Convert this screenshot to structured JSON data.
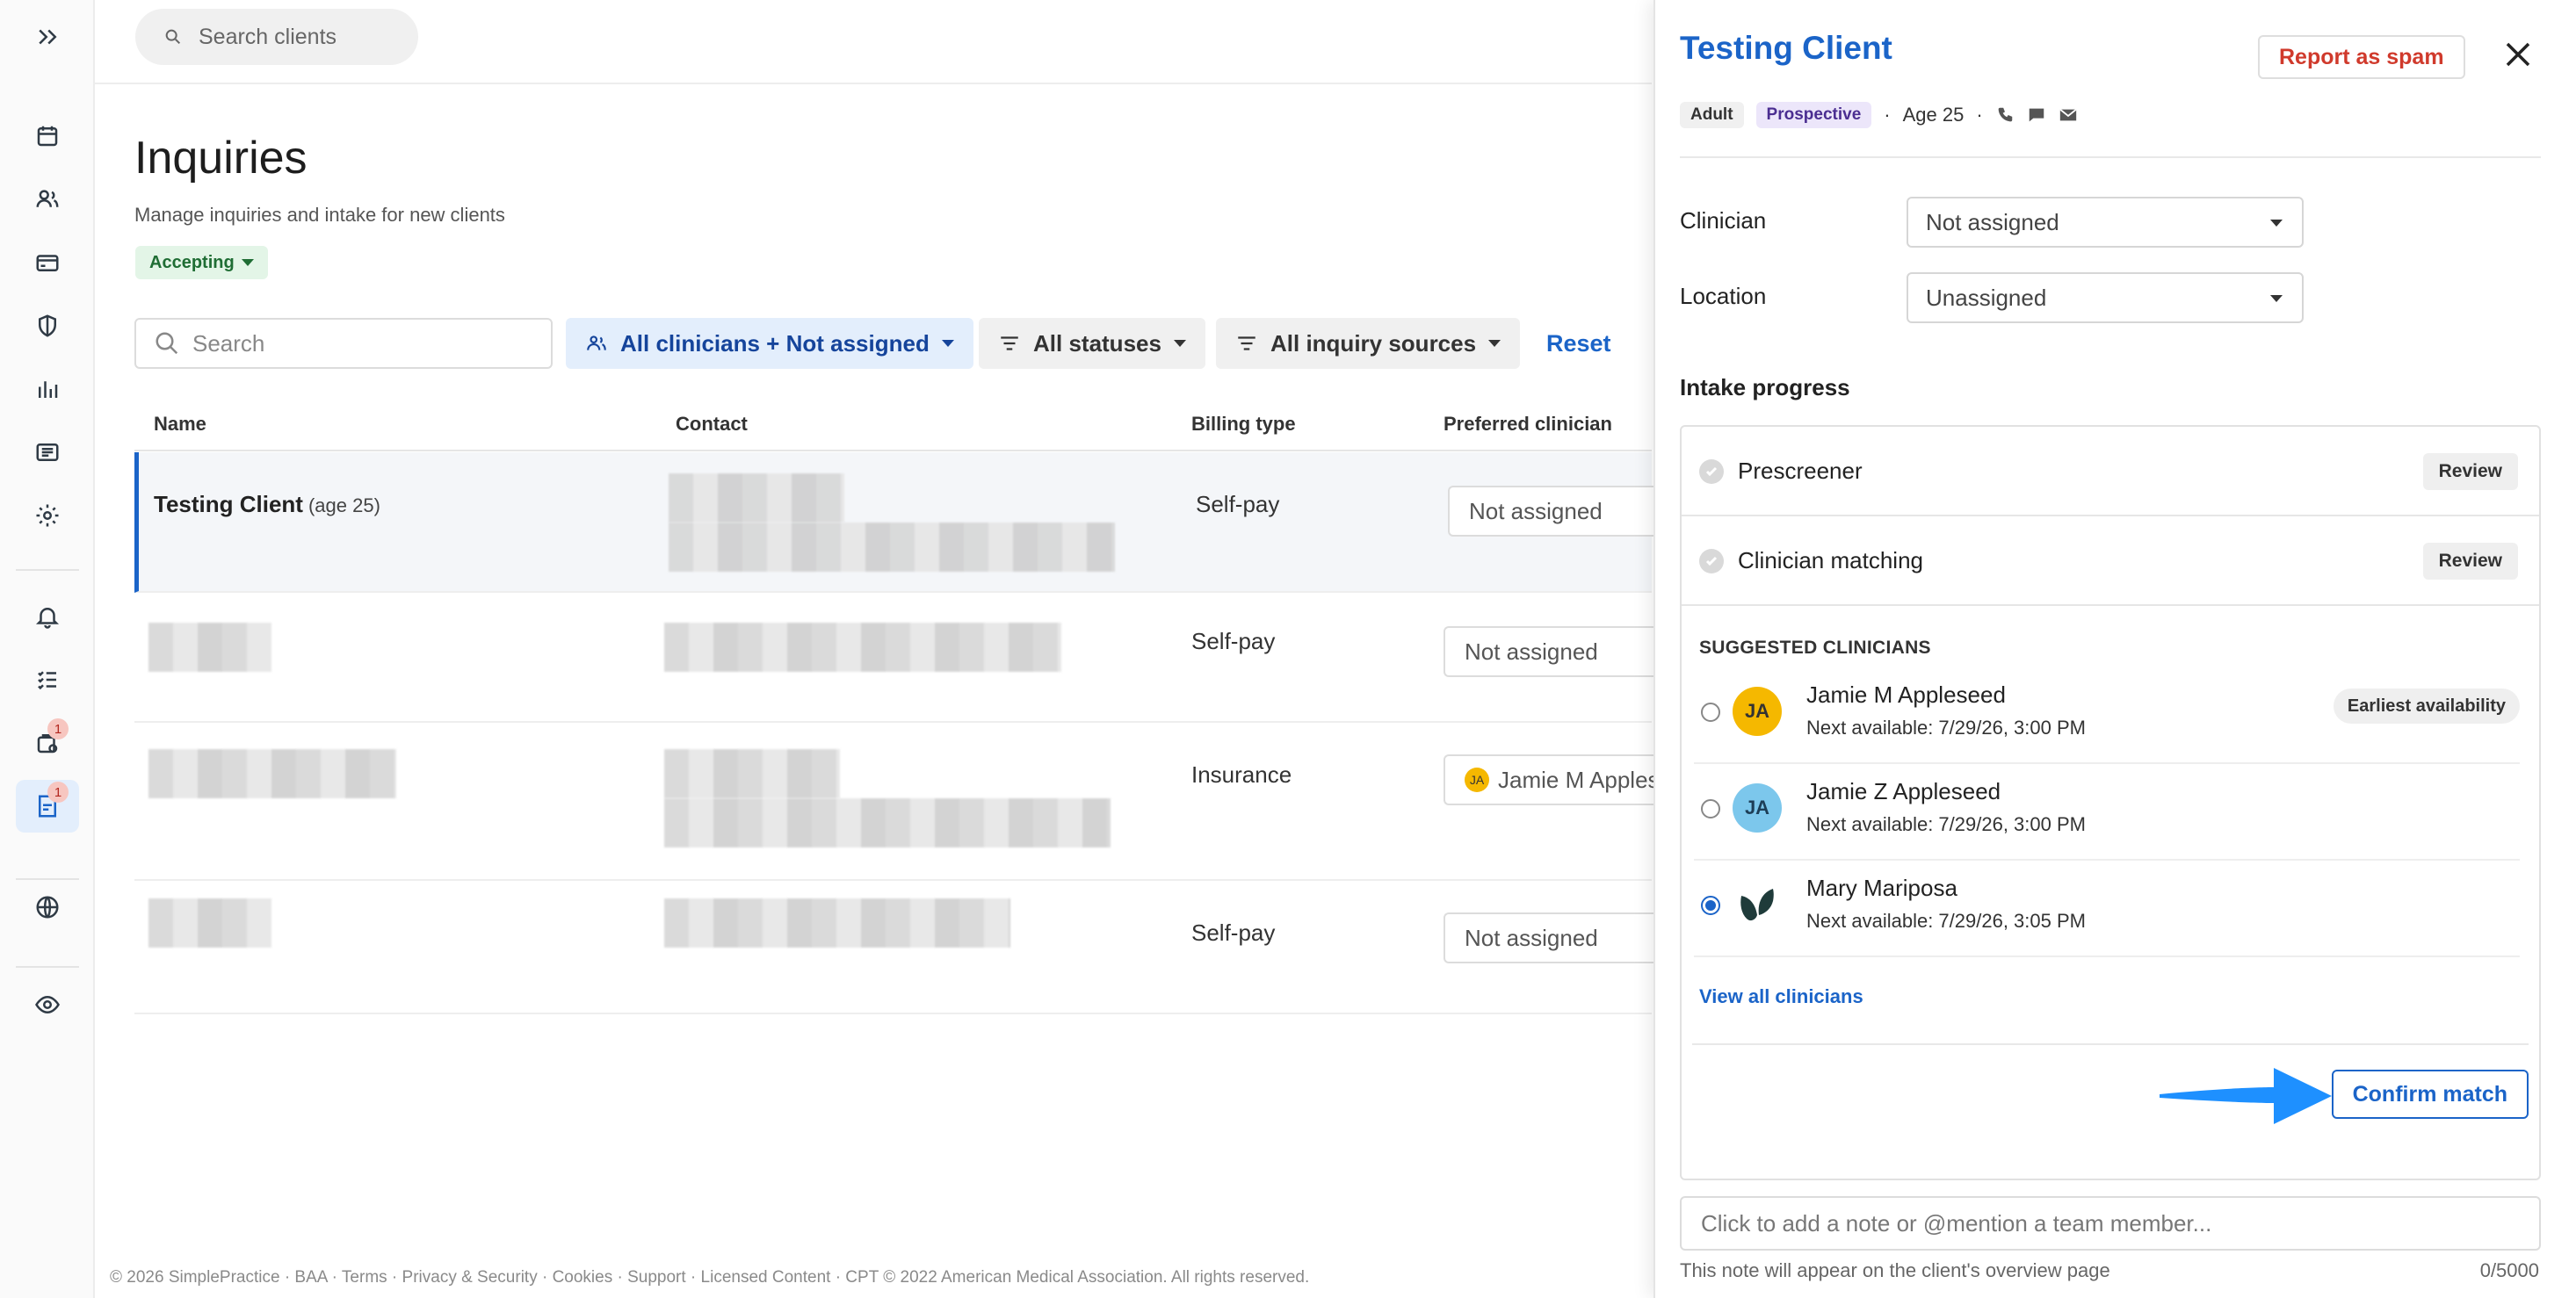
{
  "search": {
    "placeholder": "Search clients"
  },
  "nav": {
    "items": [
      {
        "icon": "expand-icon"
      },
      {
        "icon": "calendar-icon"
      },
      {
        "icon": "clients-icon"
      },
      {
        "icon": "billing-icon"
      },
      {
        "icon": "shield-icon"
      },
      {
        "icon": "analytics-icon"
      },
      {
        "icon": "list-icon"
      },
      {
        "icon": "settings-icon"
      },
      {
        "icon": "bell-icon"
      },
      {
        "icon": "tasks-icon"
      },
      {
        "icon": "requests-icon",
        "badge": "1"
      },
      {
        "icon": "inquiries-icon",
        "badge": "1",
        "active": true
      },
      {
        "icon": "globe-icon"
      },
      {
        "icon": "eye-icon"
      }
    ]
  },
  "main": {
    "title": "Inquiries",
    "subtitle": "Manage inquiries and intake for new clients",
    "status_pill": "Accepting",
    "filters": {
      "search_placeholder": "Search",
      "clinicians": "All clinicians + Not assigned",
      "statuses": "All statuses",
      "sources": "All inquiry sources",
      "reset": "Reset"
    },
    "table": {
      "columns": [
        "Name",
        "Contact",
        "Billing type",
        "Preferred clinician"
      ],
      "rows": [
        {
          "name": "Testing Client",
          "age": "(age 25)",
          "billing": "Self-pay",
          "clinician": "Not assigned"
        },
        {
          "name": "",
          "age": "",
          "billing": "Self-pay",
          "clinician": "Not assigned"
        },
        {
          "name": "",
          "age": "",
          "billing": "Insurance",
          "clinician": "Jamie M Apples",
          "clinician_initials": "JA"
        },
        {
          "name": "",
          "age": "",
          "billing": "Self-pay",
          "clinician": "Not assigned"
        }
      ]
    },
    "footer": "© 2026 SimplePractice · BAA · Terms · Privacy & Security · Cookies · Support · Licensed Content · CPT © 2022 American Medical Association. All rights reserved."
  },
  "panel": {
    "client_name": "Testing Client",
    "spam_label": "Report as spam",
    "tags": {
      "adult": "Adult",
      "prospective": "Prospective",
      "age": "Age 25"
    },
    "clinician_label": "Clinician",
    "clinician_value": "Not assigned",
    "location_label": "Location",
    "location_value": "Unassigned",
    "intake_heading": "Intake progress",
    "steps": [
      {
        "label": "Prescreener",
        "action": "Review"
      },
      {
        "label": "Clinician matching",
        "action": "Review"
      }
    ],
    "suggested_heading": "SUGGESTED CLINICIANS",
    "clinicians": [
      {
        "name": "Jamie M Appleseed",
        "initials": "JA",
        "next": "Next available: 7/29/26, 3:00 PM",
        "badge": "Earliest availability",
        "selected": false
      },
      {
        "name": "Jamie Z Appleseed",
        "initials": "JA",
        "next": "Next available: 7/29/26, 3:00 PM",
        "badge": "",
        "selected": false
      },
      {
        "name": "Mary Mariposa",
        "initials": "",
        "next": "Next available: 7/29/26, 3:05 PM",
        "badge": "",
        "selected": true
      }
    ],
    "view_all": "View all clinicians",
    "confirm_label": "Confirm match",
    "note_placeholder": "Click to add a note or @mention a team member...",
    "note_help": "This note will appear on the client's overview page",
    "note_count": "0/5000"
  },
  "colors": {
    "accent": "#1b64c8",
    "spam": "#d03a2c",
    "accepting_bg": "#e3f5e7",
    "arrow": "#1e90ff"
  }
}
